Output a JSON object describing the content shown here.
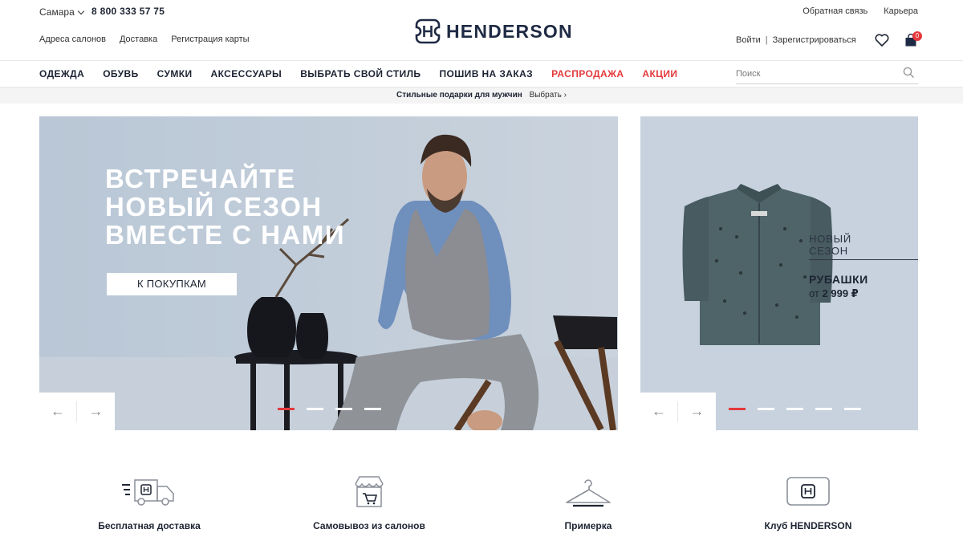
{
  "header": {
    "city": "Самара",
    "phone": "8 800 333 57 75",
    "left_links": [
      "Адреса салонов",
      "Доставка",
      "Регистрация карты"
    ],
    "brand": "HENDERSON",
    "right_top_links": [
      "Обратная связь",
      "Карьера"
    ],
    "login": "Войти",
    "separator": "|",
    "register": "Зарегистрироваться",
    "cart_count": "0"
  },
  "nav": {
    "items": [
      {
        "label": "ОДЕЖДА"
      },
      {
        "label": "ОБУВЬ"
      },
      {
        "label": "СУМКИ"
      },
      {
        "label": "АКСЕССУАРЫ"
      },
      {
        "label": "ВЫБРАТЬ СВОЙ СТИЛЬ"
      },
      {
        "label": "ПОШИВ НА ЗАКАЗ"
      },
      {
        "label": "РАСПРОДАЖА"
      },
      {
        "label": "АКЦИИ"
      }
    ],
    "search_placeholder": "Поиск"
  },
  "promo": {
    "text": "Стильные подарки для мужчин",
    "link": "Выбрать ›"
  },
  "banner_main": {
    "title_lines": [
      "ВСТРЕЧАЙТЕ",
      "НОВЫЙ СЕЗОН",
      "ВМЕСТЕ С НАМИ"
    ],
    "button": "К ПОКУПКАМ",
    "prev": "←",
    "next": "→",
    "slide_count": 4,
    "active_slide": 1
  },
  "banner_side": {
    "new_line1": "НОВЫЙ",
    "new_line2": "СЕЗОН",
    "category": "РУБАШКИ",
    "price_prefix": "от",
    "price": "2 999 ₽",
    "prev": "←",
    "next": "→",
    "slide_count": 5,
    "active_slide": 1
  },
  "features": [
    {
      "label": "Бесплатная доставка",
      "icon": "delivery-truck-icon"
    },
    {
      "label": "Самовывоз из салонов",
      "icon": "store-pickup-icon"
    },
    {
      "label": "Примерка",
      "icon": "hanger-icon"
    },
    {
      "label": "Клуб HENDERSON",
      "icon": "club-card-icon"
    }
  ],
  "colors": {
    "brand_navy": "#1f2a44",
    "accent_red": "#e4393c",
    "banner_bg": "#c3ceda"
  }
}
